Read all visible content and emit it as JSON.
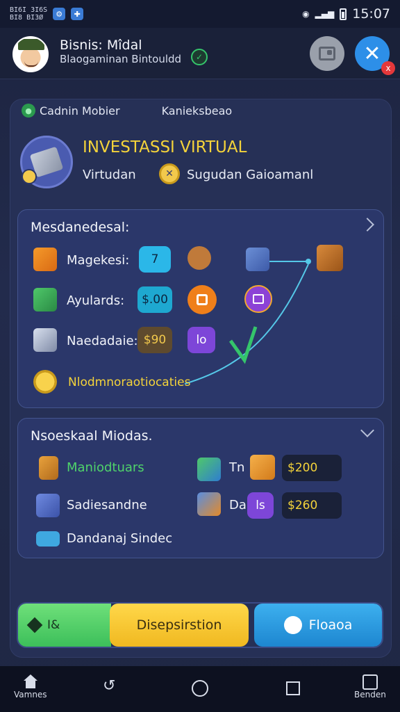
{
  "status_bar": {
    "codes_line1": "BI6I 3I6S",
    "codes_line2": "BI8 BI3Ø",
    "time": "15:07"
  },
  "header": {
    "title": "Bisnis: Mîdal",
    "subtitle": "Blaogaminan Bintouldd"
  },
  "main": {
    "link_left": "Cadnin Mobier",
    "link_right": "Kanieksbeao",
    "hero_title": "INVESTASSI VIRTUAL",
    "hero_sub_left": "Virtudan",
    "hero_sub_right": "Sugudan Gaioamanl"
  },
  "panel1": {
    "title": "Mesdanedesal:",
    "rows": [
      {
        "label": "Magekesi:",
        "value": "7"
      },
      {
        "label": "Ayulards:",
        "value": "$.00"
      },
      {
        "label": "Naedadaie:",
        "value": "$90",
        "extra": "lo"
      }
    ],
    "note": "Nlodmnoraotiocaties"
  },
  "panel2": {
    "title": "Nsoeskaal Miodas.",
    "rows": [
      {
        "label": "Maniodtuars",
        "mid": "Tn",
        "value": "$200"
      },
      {
        "label": "Sadiesandne",
        "mid": "Da",
        "mid_badge": "ls",
        "value": "$260"
      },
      {
        "label": "Dandanaj Sindec"
      }
    ]
  },
  "actions": {
    "a": "I&",
    "b": "Disepsirstion",
    "c": "Floaoa"
  },
  "nav": {
    "home": "Vamnes",
    "right": "Benden"
  },
  "colors": {
    "accent_yellow": "#f4d33a",
    "accent_blue": "#2d8fe8",
    "accent_green": "#4fd36a",
    "bg": "#1d2440"
  }
}
